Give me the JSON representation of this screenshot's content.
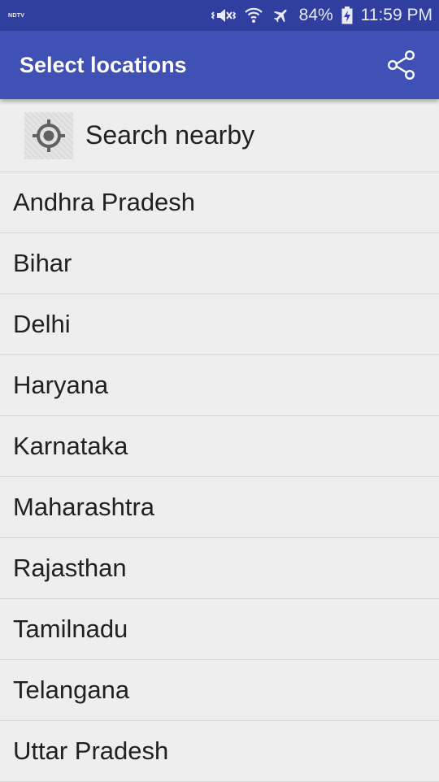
{
  "status_bar": {
    "left_label": "NDTV",
    "battery": "84%",
    "time": "11:59 PM",
    "icons": [
      "vibrate-mute-icon",
      "wifi-icon",
      "airplane-mode-icon",
      "battery-charging-icon"
    ]
  },
  "app_bar": {
    "title": "Select locations",
    "share_icon": "share-icon",
    "color": "#3f51b5",
    "status_color": "#303f9f"
  },
  "nearby": {
    "label": "Search nearby",
    "icon": "location-target-icon"
  },
  "locations": [
    "Andhra Pradesh",
    "Bihar",
    "Delhi",
    "Haryana",
    "Karnataka",
    "Maharashtra",
    "Rajasthan",
    "Tamilnadu",
    "Telangana",
    "Uttar Pradesh"
  ]
}
